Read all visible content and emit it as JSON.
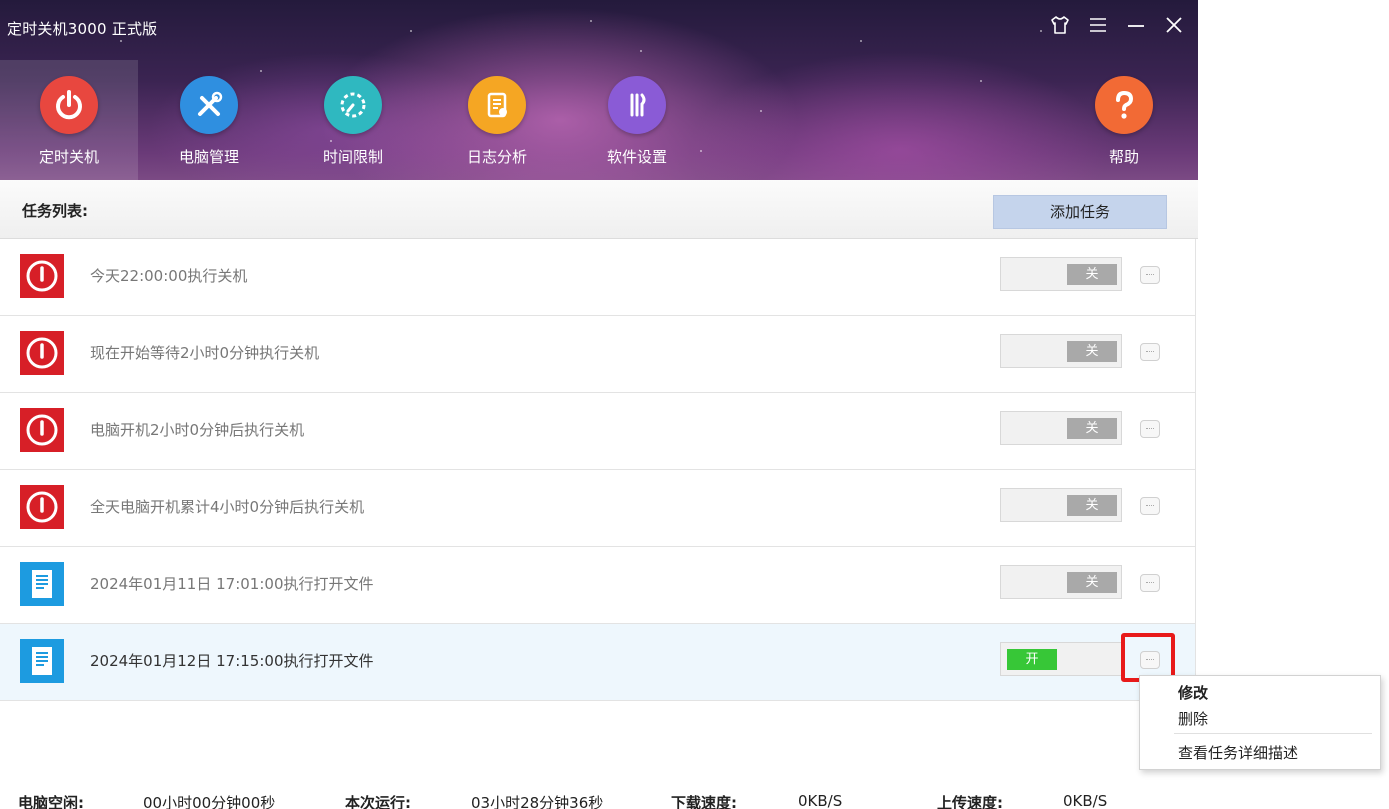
{
  "window": {
    "title": "定时关机3000 正式版",
    "controls": [
      "skin-icon",
      "menu-icon",
      "minimize-icon",
      "close-icon"
    ]
  },
  "nav": [
    {
      "label": "定时关机",
      "icon": "power-icon",
      "color": "#e8473f",
      "active": true
    },
    {
      "label": "电脑管理",
      "icon": "tools-icon",
      "color": "#2f8fe0",
      "active": false
    },
    {
      "label": "时间限制",
      "icon": "timer-icon",
      "color": "#2fb8c0",
      "active": false
    },
    {
      "label": "日志分析",
      "icon": "log-icon",
      "color": "#f5a623",
      "active": false
    },
    {
      "label": "软件设置",
      "icon": "wrench-icon",
      "color": "#8a5bd6",
      "active": false
    },
    {
      "label": "帮助",
      "icon": "help-icon",
      "color": "#f26a35",
      "active": false
    }
  ],
  "toolbar": {
    "title": "任务列表:",
    "add_label": "添加任务"
  },
  "tasks": [
    {
      "text": "今天22:00:00执行关机",
      "type": "shutdown",
      "state": "关",
      "on": false
    },
    {
      "text": "现在开始等待2小时0分钟执行关机",
      "type": "shutdown",
      "state": "关",
      "on": false
    },
    {
      "text": "电脑开机2小时0分钟后执行关机",
      "type": "shutdown",
      "state": "关",
      "on": false
    },
    {
      "text": "全天电脑开机累计4小时0分钟后执行关机",
      "type": "shutdown",
      "state": "关",
      "on": false
    },
    {
      "text": "2024年01月11日 17:01:00执行打开文件",
      "type": "file",
      "state": "关",
      "on": false
    },
    {
      "text": "2024年01月12日 17:15:00执行打开文件",
      "type": "file",
      "state": "开",
      "on": true
    }
  ],
  "context_menu": {
    "edit": "修改",
    "delete": "删除",
    "details": "查看任务详细描述"
  },
  "status": {
    "idle_label": "电脑空闲:",
    "idle_value": "00小时00分钟00秒",
    "run_label": "本次运行:",
    "run_value": "03小时28分钟36秒",
    "down_label": "下载速度:",
    "down_value": "0KB/S",
    "up_label": "上传速度:",
    "up_value": "0KB/S"
  }
}
